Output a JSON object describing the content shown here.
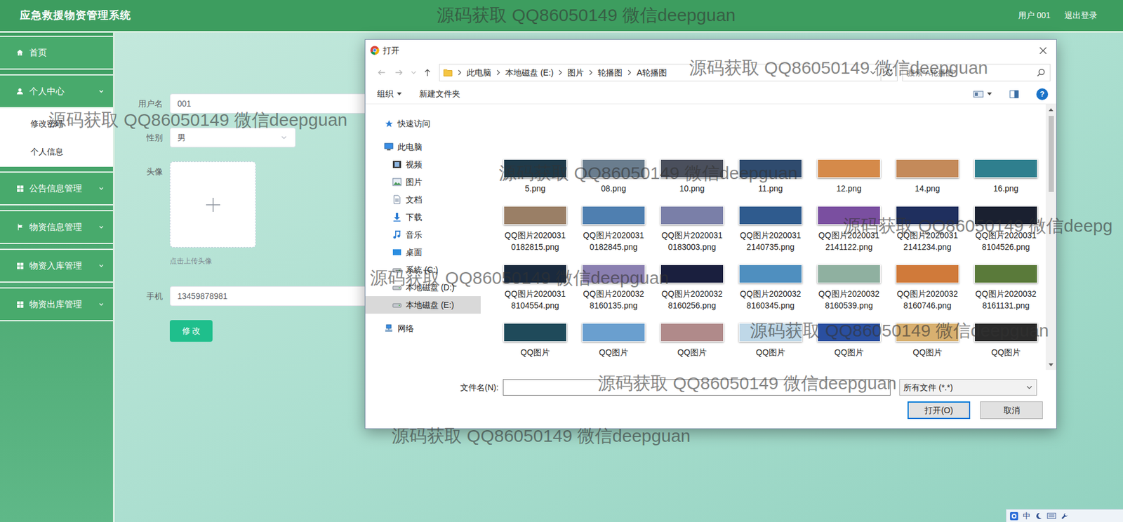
{
  "app": {
    "title": "应急救援物资管理系统",
    "user": "用户 001",
    "logout": "退出登录"
  },
  "sidebar": {
    "items": [
      {
        "label": "首页",
        "kind": "home",
        "expandable": false,
        "expanded": false,
        "children": []
      },
      {
        "label": "个人中心",
        "kind": "user",
        "expandable": true,
        "expanded": true,
        "children": [
          {
            "label": "修改密码"
          },
          {
            "label": "个人信息"
          }
        ]
      },
      {
        "label": "公告信息管理",
        "kind": "grid",
        "expandable": true,
        "expanded": false,
        "children": []
      },
      {
        "label": "物资信息管理",
        "kind": "flag",
        "expandable": true,
        "expanded": false,
        "children": []
      },
      {
        "label": "物资入库管理",
        "kind": "grid",
        "expandable": true,
        "expanded": false,
        "children": []
      },
      {
        "label": "物资出库管理",
        "kind": "grid",
        "expandable": true,
        "expanded": false,
        "children": []
      }
    ]
  },
  "form": {
    "fields": [
      {
        "label": "用户名",
        "kind": "text",
        "value": "001"
      },
      {
        "label": "性别",
        "kind": "select",
        "value": "男"
      },
      {
        "label": "头像",
        "kind": "avatar",
        "hint": "点击上传头像"
      },
      {
        "label": "手机",
        "kind": "text",
        "value": "13459878981"
      }
    ],
    "button": "修 改"
  },
  "dialog": {
    "title": "打开",
    "path": [
      "此电脑",
      "本地磁盘 (E:)",
      "图片",
      "轮播图",
      "A轮播图"
    ],
    "search": {
      "placeholder": "搜索“A轮播图”"
    },
    "toolbar": {
      "items": [
        "组织",
        "新建文件夹"
      ],
      "help": "?"
    },
    "tree": [
      {
        "label": "快速访问",
        "kind": "star",
        "selected": false,
        "children": []
      },
      {
        "label": "此电脑",
        "kind": "pc",
        "selected": false,
        "children": [
          {
            "label": "视频",
            "kind": "video",
            "selected": false
          },
          {
            "label": "图片",
            "kind": "pictures",
            "selected": false
          },
          {
            "label": "文档",
            "kind": "docs",
            "selected": false
          },
          {
            "label": "下载",
            "kind": "download",
            "selected": false
          },
          {
            "label": "音乐",
            "kind": "music",
            "selected": false
          },
          {
            "label": "桌面",
            "kind": "desktop",
            "selected": false
          },
          {
            "label": "系统 (C:)",
            "kind": "drive",
            "selected": false
          },
          {
            "label": "本地磁盘 (D:)",
            "kind": "drive",
            "selected": false
          },
          {
            "label": "本地磁盘 (E:)",
            "kind": "drive",
            "selected": true
          }
        ]
      },
      {
        "label": "网络",
        "kind": "network",
        "selected": false,
        "children": []
      }
    ],
    "files": [
      {
        "name": "5.png",
        "color": "#1f3a4a"
      },
      {
        "name": "08.png",
        "color": "#6a7d8e"
      },
      {
        "name": "10.png",
        "color": "#4a4f5c"
      },
      {
        "name": "11.png",
        "color": "#2f4b6e"
      },
      {
        "name": "12.png",
        "color": "#d58a4a"
      },
      {
        "name": "14.png",
        "color": "#c48a5a"
      },
      {
        "name": "16.png",
        "color": "#2f7f8e"
      },
      {
        "name": "QQ图片20200310182815.png",
        "color": "#9a7f66"
      },
      {
        "name": "QQ图片20200310182845.png",
        "color": "#4f7fb0"
      },
      {
        "name": "QQ图片20200310183003.png",
        "color": "#7a7fa8"
      },
      {
        "name": "QQ图片20200312140735.png",
        "color": "#2f5b8e"
      },
      {
        "name": "QQ图片20200312141122.png",
        "color": "#7a4fa0"
      },
      {
        "name": "QQ图片20200312141234.png",
        "color": "#1f2f5e"
      },
      {
        "name": "QQ图片20200318104526.png",
        "color": "#1a2030"
      },
      {
        "name": "QQ图片20200318104554.png",
        "color": "#1a2a3e"
      },
      {
        "name": "QQ图片20200328160135.png",
        "color": "#8a7fb0"
      },
      {
        "name": "QQ图片20200328160256.png",
        "color": "#1a1f3e"
      },
      {
        "name": "QQ图片20200328160345.png",
        "color": "#4f8fbf"
      },
      {
        "name": "QQ图片20200328160539.png",
        "color": "#8fb0a0"
      },
      {
        "name": "QQ图片20200328160746.png",
        "color": "#d07a3a"
      },
      {
        "name": "QQ图片20200328161131.png",
        "color": "#5a7a3a"
      },
      {
        "name": "QQ图片",
        "color": "#1f4a5a"
      },
      {
        "name": "QQ图片",
        "color": "#6a9fcf"
      },
      {
        "name": "QQ图片",
        "color": "#b08a8a"
      },
      {
        "name": "QQ图片",
        "color": "#bfd8e8"
      },
      {
        "name": "QQ图片",
        "color": "#2a4fa0"
      },
      {
        "name": "QQ图片",
        "color": "#d8b070"
      },
      {
        "name": "QQ图片",
        "color": "#2a2a2a"
      }
    ],
    "filename": {
      "label": "文件名(N):",
      "value": ""
    },
    "filter": "所有文件 (*.*)",
    "buttons": [
      {
        "label": "打开(O)",
        "default": true
      },
      {
        "label": "取消",
        "default": false
      }
    ]
  },
  "watermarks": [
    "源码获取 QQ86050149 微信deepguan",
    "源码获取 QQ86050149 微信deepguan",
    "源码获取 QQ86050149 微信deepguan",
    "源码获取 QQ86050149 微信deepguan",
    "源码获取 QQ86050149 微信deepg",
    "源码获取 QQ86050149 微信deepguan",
    "源码获取 QQ86050149 微信deepguan",
    "源码获取 QQ86050149 微信deepguan",
    "源码获取 QQ86050149 微信deepguan"
  ],
  "tray": {
    "ime": "中"
  }
}
